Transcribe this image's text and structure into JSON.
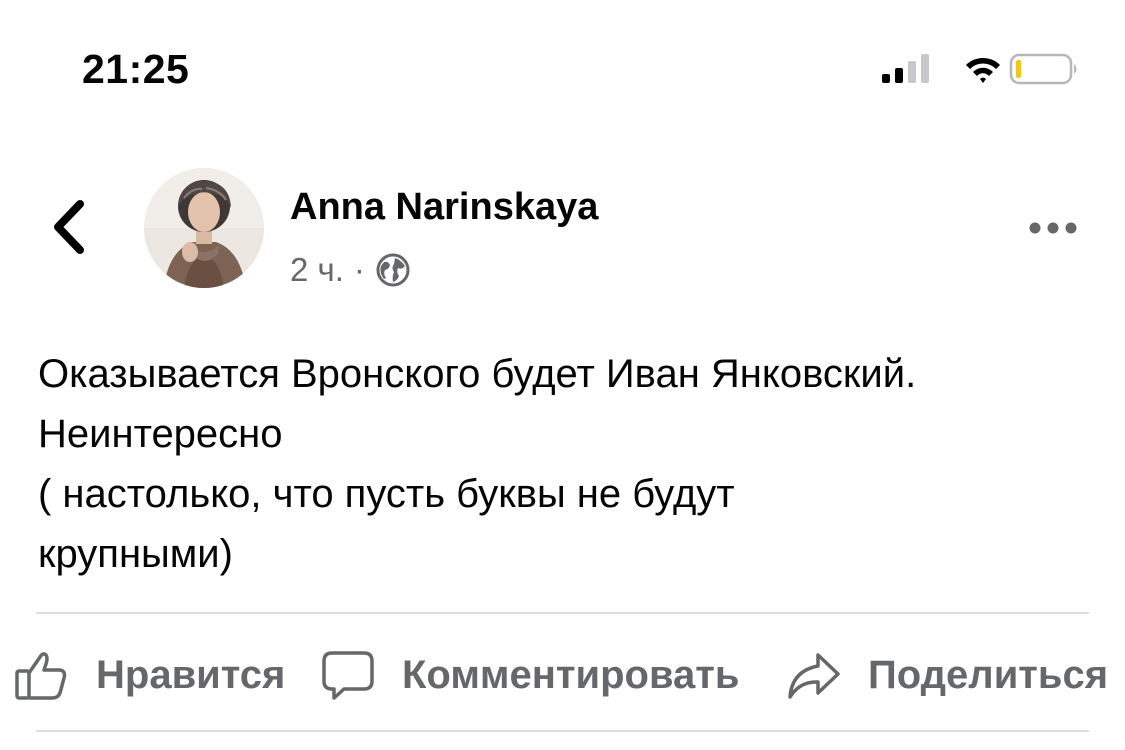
{
  "status_bar": {
    "time": "21:25",
    "icons": [
      "cellular-signal-icon",
      "wifi-icon",
      "battery-low-icon"
    ]
  },
  "post": {
    "author": "Anna Narinskaya",
    "time_ago": "2 ч.",
    "separator": "·",
    "audience_icon": "globe-icon",
    "text_lines": [
      "Оказывается Вронского будет Иван Янковский.",
      "Неинтересно",
      "( настолько, что пусть буквы не будут",
      "крупными)"
    ]
  },
  "actions": {
    "like_label": "Нравится",
    "comment_label": "Комментировать",
    "share_label": "Поделиться"
  },
  "colors": {
    "text_primary": "#050505",
    "text_secondary": "#65676b",
    "divider": "#dcdde1",
    "battery_level": "#f5c518"
  }
}
